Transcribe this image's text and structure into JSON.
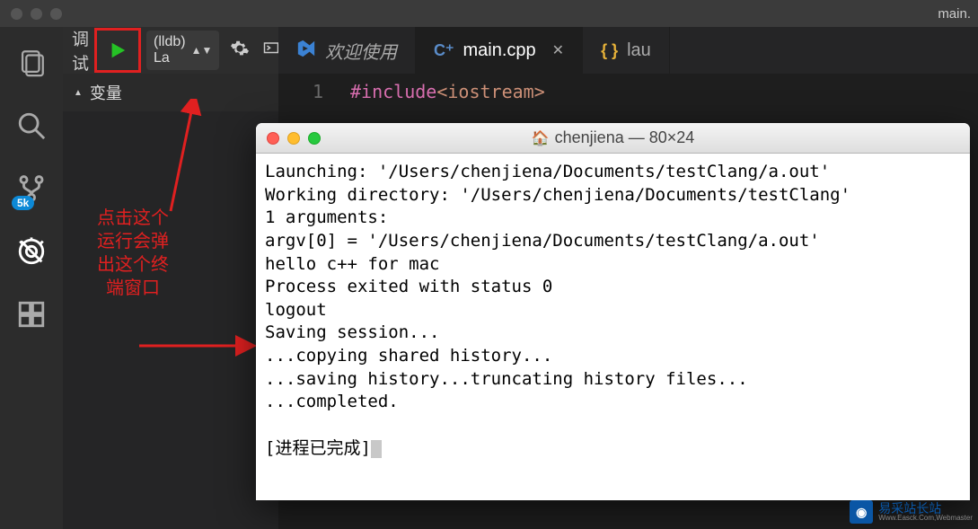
{
  "window": {
    "title": "main."
  },
  "activity": {
    "items": [
      {
        "name": "explorer"
      },
      {
        "name": "search"
      },
      {
        "name": "source-control",
        "badge": "5k"
      },
      {
        "name": "debug"
      },
      {
        "name": "extensions"
      }
    ]
  },
  "debug": {
    "label": "调试",
    "config": "(lldb) La",
    "section_variables": "变量"
  },
  "tabs": {
    "welcome": "欢迎使用",
    "main": "main.cpp",
    "launch": "lau"
  },
  "code": {
    "line1_no": "1",
    "line1_include": "#include",
    "line1_header": "<iostream>"
  },
  "annotation": {
    "l1": "点击这个",
    "l2": "运行会弹",
    "l3": "出这个终",
    "l4": "端窗口"
  },
  "terminal": {
    "title": "chenjiena — 80×24",
    "lines": [
      "Launching: '/Users/chenjiena/Documents/testClang/a.out'",
      "Working directory: '/Users/chenjiena/Documents/testClang'",
      "1 arguments:",
      "argv[0] = '/Users/chenjiena/Documents/testClang/a.out'",
      "hello c++ for mac",
      "Process exited with status 0",
      "logout",
      "Saving session...",
      "...copying shared history...",
      "...saving history...truncating history files...",
      "...completed.",
      "",
      "[进程已完成]"
    ]
  },
  "watermark": {
    "name": "易采站长站",
    "sub": "Www.Easck.Com,Webmaster"
  }
}
